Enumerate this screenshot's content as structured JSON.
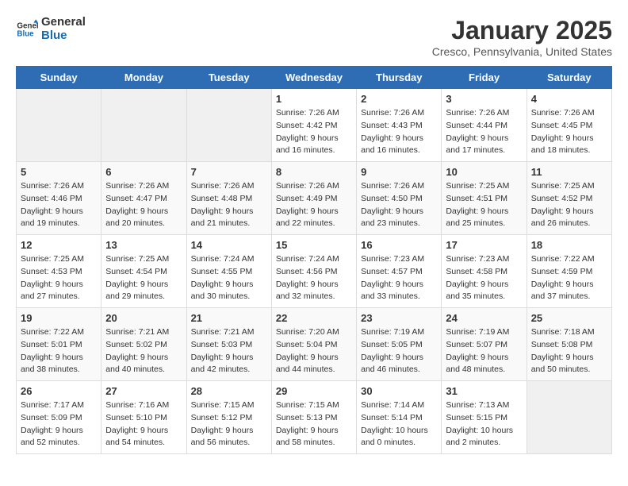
{
  "logo": {
    "line1": "General",
    "line2": "Blue"
  },
  "title": "January 2025",
  "location": "Cresco, Pennsylvania, United States",
  "days_of_week": [
    "Sunday",
    "Monday",
    "Tuesday",
    "Wednesday",
    "Thursday",
    "Friday",
    "Saturday"
  ],
  "weeks": [
    [
      {
        "day": "",
        "info": ""
      },
      {
        "day": "",
        "info": ""
      },
      {
        "day": "",
        "info": ""
      },
      {
        "day": "1",
        "info": "Sunrise: 7:26 AM\nSunset: 4:42 PM\nDaylight: 9 hours\nand 16 minutes."
      },
      {
        "day": "2",
        "info": "Sunrise: 7:26 AM\nSunset: 4:43 PM\nDaylight: 9 hours\nand 16 minutes."
      },
      {
        "day": "3",
        "info": "Sunrise: 7:26 AM\nSunset: 4:44 PM\nDaylight: 9 hours\nand 17 minutes."
      },
      {
        "day": "4",
        "info": "Sunrise: 7:26 AM\nSunset: 4:45 PM\nDaylight: 9 hours\nand 18 minutes."
      }
    ],
    [
      {
        "day": "5",
        "info": "Sunrise: 7:26 AM\nSunset: 4:46 PM\nDaylight: 9 hours\nand 19 minutes."
      },
      {
        "day": "6",
        "info": "Sunrise: 7:26 AM\nSunset: 4:47 PM\nDaylight: 9 hours\nand 20 minutes."
      },
      {
        "day": "7",
        "info": "Sunrise: 7:26 AM\nSunset: 4:48 PM\nDaylight: 9 hours\nand 21 minutes."
      },
      {
        "day": "8",
        "info": "Sunrise: 7:26 AM\nSunset: 4:49 PM\nDaylight: 9 hours\nand 22 minutes."
      },
      {
        "day": "9",
        "info": "Sunrise: 7:26 AM\nSunset: 4:50 PM\nDaylight: 9 hours\nand 23 minutes."
      },
      {
        "day": "10",
        "info": "Sunrise: 7:25 AM\nSunset: 4:51 PM\nDaylight: 9 hours\nand 25 minutes."
      },
      {
        "day": "11",
        "info": "Sunrise: 7:25 AM\nSunset: 4:52 PM\nDaylight: 9 hours\nand 26 minutes."
      }
    ],
    [
      {
        "day": "12",
        "info": "Sunrise: 7:25 AM\nSunset: 4:53 PM\nDaylight: 9 hours\nand 27 minutes."
      },
      {
        "day": "13",
        "info": "Sunrise: 7:25 AM\nSunset: 4:54 PM\nDaylight: 9 hours\nand 29 minutes."
      },
      {
        "day": "14",
        "info": "Sunrise: 7:24 AM\nSunset: 4:55 PM\nDaylight: 9 hours\nand 30 minutes."
      },
      {
        "day": "15",
        "info": "Sunrise: 7:24 AM\nSunset: 4:56 PM\nDaylight: 9 hours\nand 32 minutes."
      },
      {
        "day": "16",
        "info": "Sunrise: 7:23 AM\nSunset: 4:57 PM\nDaylight: 9 hours\nand 33 minutes."
      },
      {
        "day": "17",
        "info": "Sunrise: 7:23 AM\nSunset: 4:58 PM\nDaylight: 9 hours\nand 35 minutes."
      },
      {
        "day": "18",
        "info": "Sunrise: 7:22 AM\nSunset: 4:59 PM\nDaylight: 9 hours\nand 37 minutes."
      }
    ],
    [
      {
        "day": "19",
        "info": "Sunrise: 7:22 AM\nSunset: 5:01 PM\nDaylight: 9 hours\nand 38 minutes."
      },
      {
        "day": "20",
        "info": "Sunrise: 7:21 AM\nSunset: 5:02 PM\nDaylight: 9 hours\nand 40 minutes."
      },
      {
        "day": "21",
        "info": "Sunrise: 7:21 AM\nSunset: 5:03 PM\nDaylight: 9 hours\nand 42 minutes."
      },
      {
        "day": "22",
        "info": "Sunrise: 7:20 AM\nSunset: 5:04 PM\nDaylight: 9 hours\nand 44 minutes."
      },
      {
        "day": "23",
        "info": "Sunrise: 7:19 AM\nSunset: 5:05 PM\nDaylight: 9 hours\nand 46 minutes."
      },
      {
        "day": "24",
        "info": "Sunrise: 7:19 AM\nSunset: 5:07 PM\nDaylight: 9 hours\nand 48 minutes."
      },
      {
        "day": "25",
        "info": "Sunrise: 7:18 AM\nSunset: 5:08 PM\nDaylight: 9 hours\nand 50 minutes."
      }
    ],
    [
      {
        "day": "26",
        "info": "Sunrise: 7:17 AM\nSunset: 5:09 PM\nDaylight: 9 hours\nand 52 minutes."
      },
      {
        "day": "27",
        "info": "Sunrise: 7:16 AM\nSunset: 5:10 PM\nDaylight: 9 hours\nand 54 minutes."
      },
      {
        "day": "28",
        "info": "Sunrise: 7:15 AM\nSunset: 5:12 PM\nDaylight: 9 hours\nand 56 minutes."
      },
      {
        "day": "29",
        "info": "Sunrise: 7:15 AM\nSunset: 5:13 PM\nDaylight: 9 hours\nand 58 minutes."
      },
      {
        "day": "30",
        "info": "Sunrise: 7:14 AM\nSunset: 5:14 PM\nDaylight: 10 hours\nand 0 minutes."
      },
      {
        "day": "31",
        "info": "Sunrise: 7:13 AM\nSunset: 5:15 PM\nDaylight: 10 hours\nand 2 minutes."
      },
      {
        "day": "",
        "info": ""
      }
    ]
  ]
}
